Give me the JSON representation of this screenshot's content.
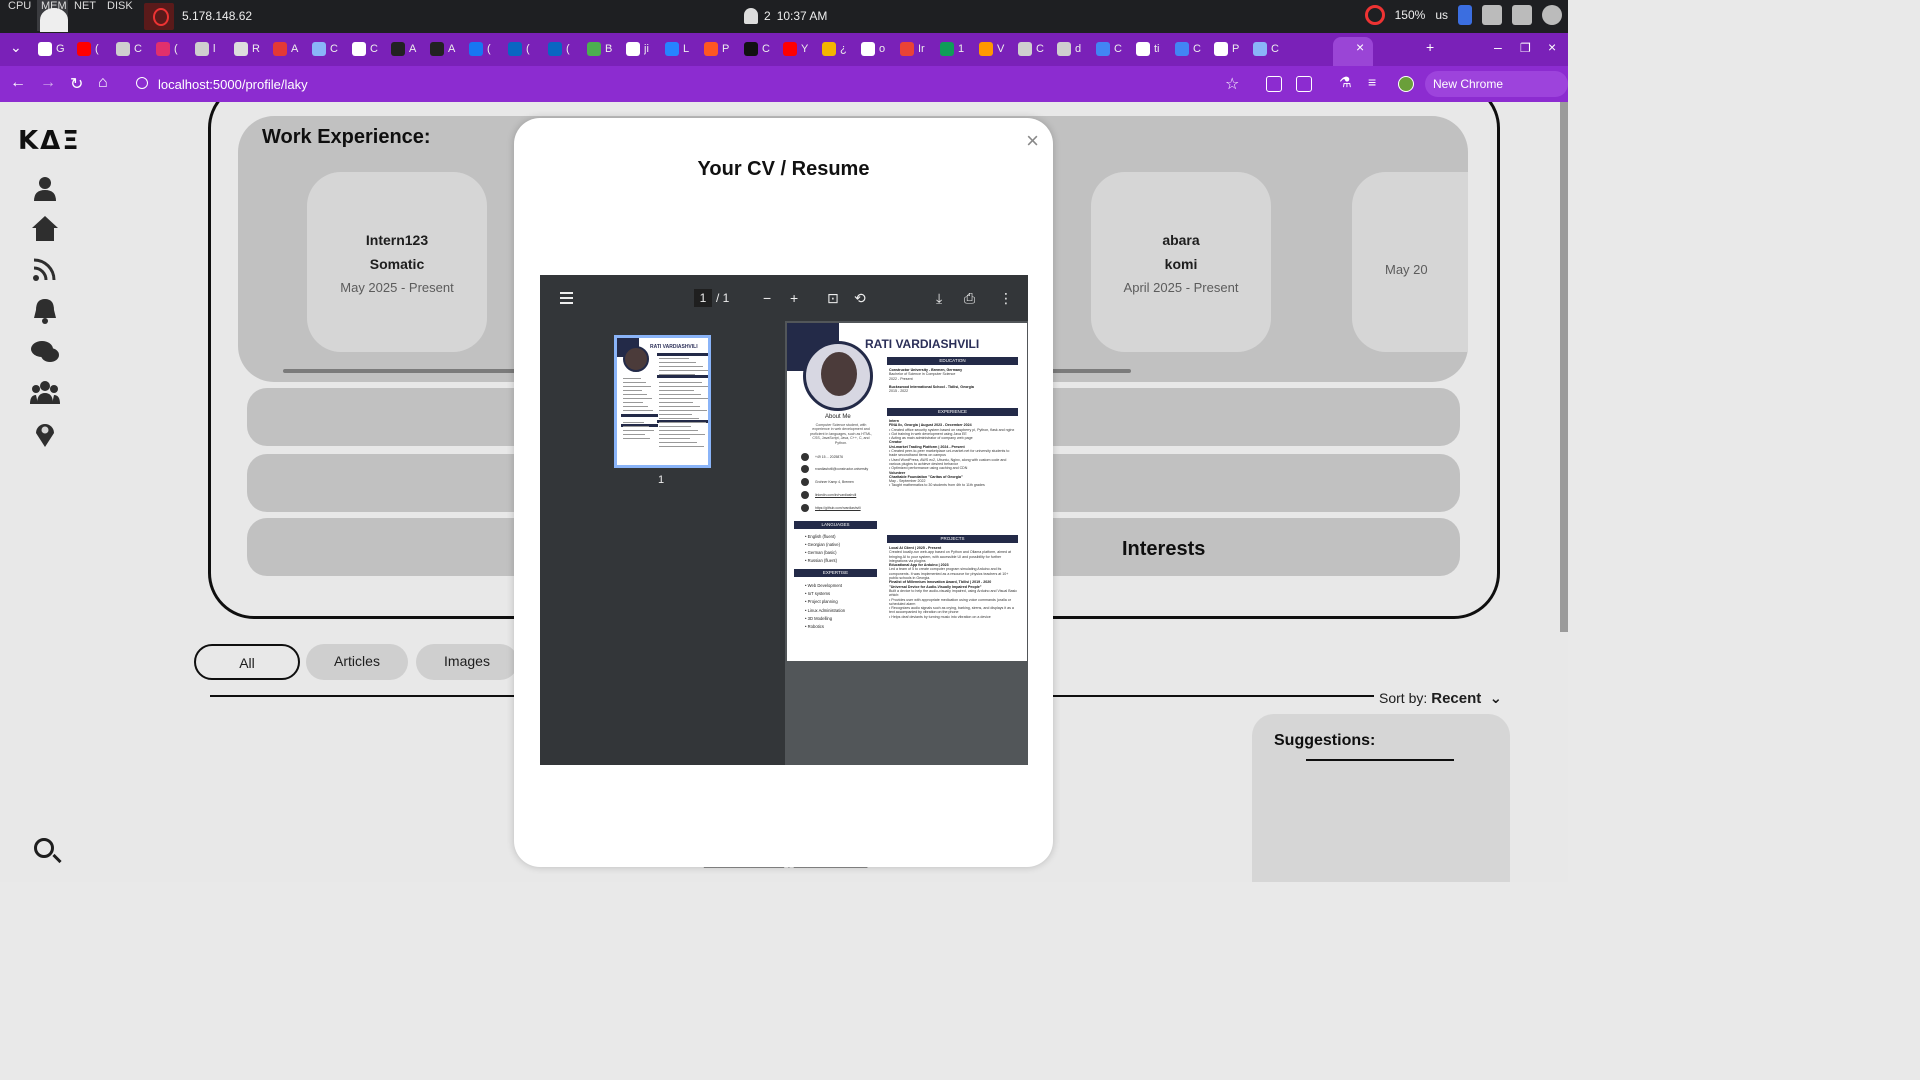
{
  "os": {
    "meters": [
      "CPU",
      "MEM",
      "NET",
      "DISK"
    ],
    "ip": "5.178.148.62",
    "notifications": "2",
    "time": "10:37 AM",
    "zoom": "150%",
    "keyboard": "us"
  },
  "browser": {
    "url": "localhost:5000/profile/laky",
    "new_chrome_label": "New Chrome available",
    "tabs": [
      {
        "icon": "github-icon",
        "label": "G",
        "color": "#ffffff"
      },
      {
        "icon": "youtube-icon",
        "label": "(",
        "color": "#ff0000"
      },
      {
        "icon": "chrome-icon",
        "label": "C",
        "color": "#cfcfcf"
      },
      {
        "icon": "instagram-icon",
        "label": "(",
        "color": "#e1306c"
      },
      {
        "icon": "chrome-icon",
        "label": "l",
        "color": "#cfcfcf"
      },
      {
        "icon": "target-icon",
        "label": "R",
        "color": "#dddddd"
      },
      {
        "icon": "gem-icon",
        "label": "A",
        "color": "#e53935"
      },
      {
        "icon": "sparkle-icon",
        "label": "C",
        "color": "#8ab4f8"
      },
      {
        "icon": "openai-icon",
        "label": "C",
        "color": "#ffffff"
      },
      {
        "icon": "w-icon",
        "label": "A",
        "color": "#222222"
      },
      {
        "icon": "w-icon",
        "label": "A",
        "color": "#222222"
      },
      {
        "icon": "facebook-icon",
        "label": "(",
        "color": "#1877f2"
      },
      {
        "icon": "linkedin-icon",
        "label": "(",
        "color": "#0a66c2"
      },
      {
        "icon": "linkedin-icon",
        "label": "(",
        "color": "#0a66c2"
      },
      {
        "icon": "b-icon",
        "label": "B",
        "color": "#4caf50"
      },
      {
        "icon": "google-icon",
        "label": "ji",
        "color": "#ffffff"
      },
      {
        "icon": "atlassian-icon",
        "label": "L",
        "color": "#2684ff"
      },
      {
        "icon": "p-icon",
        "label": "P",
        "color": "#ff5722"
      },
      {
        "icon": "h-icon",
        "label": "C",
        "color": "#111111"
      },
      {
        "icon": "youtube-icon",
        "label": "Y",
        "color": "#ff0000"
      },
      {
        "icon": "s-icon",
        "label": "¿",
        "color": "#f4b400"
      },
      {
        "icon": "google-icon",
        "label": "o",
        "color": "#ffffff"
      },
      {
        "icon": "gmail-icon",
        "label": "Ir",
        "color": "#ea4335"
      },
      {
        "icon": "sheets-icon",
        "label": "1",
        "color": "#0f9d58"
      },
      {
        "icon": "v-icon",
        "label": "V",
        "color": "#ff9800"
      },
      {
        "icon": "chrome-icon",
        "label": "C",
        "color": "#cfcfcf"
      },
      {
        "icon": "chrome-icon",
        "label": "d",
        "color": "#cfcfcf"
      },
      {
        "icon": "docs-icon",
        "label": "C",
        "color": "#4285f4"
      },
      {
        "icon": "google-icon",
        "label": "ti",
        "color": "#ffffff"
      },
      {
        "icon": "translate-icon",
        "label": "C",
        "color": "#4285f4"
      },
      {
        "icon": "p-icon",
        "label": "P",
        "color": "#ffffff"
      },
      {
        "icon": "sparkle-icon",
        "label": "C",
        "color": "#8ab4f8"
      }
    ]
  },
  "profile": {
    "work_title": "Work Experience:",
    "jobs": [
      {
        "role": "Intern123",
        "org": "Somatic",
        "date": "May 2025 - Present"
      },
      {
        "role": "abara",
        "org": "komi",
        "date": "April 2025 - Present"
      },
      {
        "role": "",
        "org": "",
        "date": "May 20"
      }
    ],
    "interests_title": "Interests",
    "filters": [
      "All",
      "Articles",
      "Images"
    ],
    "sort_label": "Sort by:",
    "sort_value": "Recent",
    "suggestions_title": "Suggestions:"
  },
  "modal": {
    "title": "Your CV / Resume",
    "close_label": "×",
    "pdf": {
      "page_current": "1",
      "page_total": "/ 1",
      "thumb_label": "1",
      "doc": {
        "name": "RATI VARDIASHVILI",
        "about_title": "About Me",
        "about_text": "Computer Science student, with experience in web development and proficient in languages, such as HTML, CSS, JavaScript, Java, C++, C, and Python.",
        "contacts": [
          "+49 15… 2025876",
          "rvardiashvili@constructor.university",
          "Grohner Kamp 4, Bremen",
          "linkedin.com/in/rvardiashvili",
          "https://github.com/rvardiashvili"
        ],
        "languages_title": "LANGUAGES",
        "languages": [
          "English (fluent)",
          "Georgian (native)",
          "German (basic)",
          "Russian (fluent)"
        ],
        "expertise_title": "EXPERTISE",
        "expertise": [
          "Web Development",
          "IoT systems",
          "Project planning",
          "Linux Administration",
          "3D Modelling",
          "Robotics"
        ],
        "education_title": "EDUCATION",
        "education": [
          "Constructor University - Bremen, Germany",
          "Bachelor of Science in Computer Science",
          "2022 - Present",
          "Buckswood International School - Tbilisi, Georgia",
          "2015 - 2022"
        ],
        "experience_title": "EXPERIENCE",
        "experience": [
          "Intern",
          "FINA llc, Georgia | August 2023 - December 2024",
          "Created office security system based on raspberry pi, Python, flask and nginx",
          "Got training in web development using Java EE",
          "Acting as main administrator of company web page",
          "Creator",
          "Uni-market Trading Platform | 2024 - Present",
          "Created peer-to-peer marketplace uni-market.net for university students to trade secondhand items on campus",
          "Used WordPress, AWS ec2, Ubuntu, Nginx, along with custom code and various plugins to achieve desired behavior",
          "Optimized performance using caching and CDN",
          "Volunteer",
          "Charitable Foundation \"Caritas of Georgia\"",
          "May - September 2022",
          "Taught mathematics to 30 students from 4th to 11th grades"
        ],
        "projects_title": "PROJECTS",
        "projects": [
          "Local AI Client | 2025 - Present",
          "Created locally-run web-app based on Python and Ollama platform, aimed at bringing AI to your system, with accessible UI and possibility for further integrations via plugins",
          "Educational App for Arduino | 2023",
          "Led a team of 5 to create computer program simulating Arduino and its components. It was implemented as a resource for physics teachers at 10+ public schools in Georgia.",
          "Finalist of Millennium Innovation Award, Tbilisi | 2019 - 2020",
          "\"Universal Device for Audio-Visually Impaired People\"",
          "Built a device to help the audio-visually impaired, using Arduino and Visual Basic which:",
          "Provides user with appropriate medication using voice commands (oralla or scheduled alarm",
          "Recognizes audio signals such as crying, barking, sirens, and displays it as a text accompanied by vibration on the phone",
          "Helps deaf deviants by turning music into vibration on a device"
        ]
      }
    }
  }
}
